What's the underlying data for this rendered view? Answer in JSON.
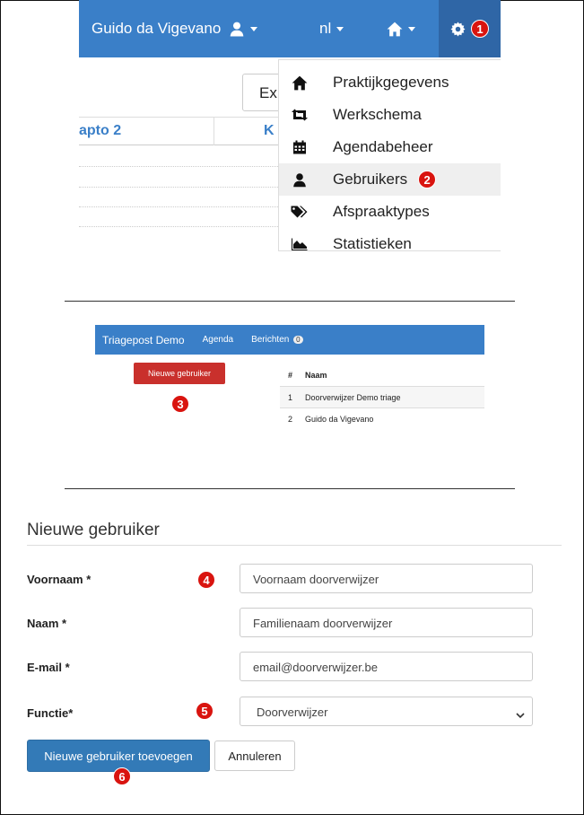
{
  "topbar": {
    "user_name": "Guido da Vigevano",
    "language": "nl"
  },
  "settings_menu": {
    "items": [
      {
        "label": "Praktijkgegevens",
        "icon": "home-icon"
      },
      {
        "label": "Werkschema",
        "icon": "retweet-icon"
      },
      {
        "label": "Agendabeheer",
        "icon": "calendar-icon"
      },
      {
        "label": "Gebruikers",
        "icon": "user-icon"
      },
      {
        "label": "Afspraaktypes",
        "icon": "tags-icon"
      },
      {
        "label": "Statistieken",
        "icon": "area-chart-icon"
      }
    ]
  },
  "background_table": {
    "export_label": "Ex",
    "col1_header": "apto 2",
    "col2_header": "K"
  },
  "steps": {
    "s1": "1",
    "s2": "2",
    "s3": "3",
    "s4": "4",
    "s5": "5",
    "s6": "6"
  },
  "mini_navbar": {
    "brand": "Triagepost Demo",
    "agenda": "Agenda",
    "berichten": "Berichten",
    "berichten_count": "0"
  },
  "users_list": {
    "new_user_button": "Nieuwe gebruiker",
    "col_number": "#",
    "col_name": "Naam",
    "rows": [
      {
        "n": "1",
        "name": "Doorverwijzer Demo triage"
      },
      {
        "n": "2",
        "name": "Guido da Vigevano"
      }
    ]
  },
  "form": {
    "title": "Nieuwe gebruiker",
    "firstname_label": "Voornaam *",
    "firstname_value": "Voornaam doorverwijzer",
    "lastname_label": "Naam *",
    "lastname_value": "Familienaam doorverwijzer",
    "email_label": "E-mail *",
    "email_value": "email@doorverwijzer.be",
    "function_label": "Functie*",
    "function_value": "Doorverwijzer",
    "submit_label": "Nieuwe gebruiker toevoegen",
    "cancel_label": "Annuleren"
  },
  "colors": {
    "navbar_blue": "#3a7fc8",
    "badge_red": "#d9140f",
    "danger_button": "#c9302c",
    "primary_button": "#337ab7"
  }
}
